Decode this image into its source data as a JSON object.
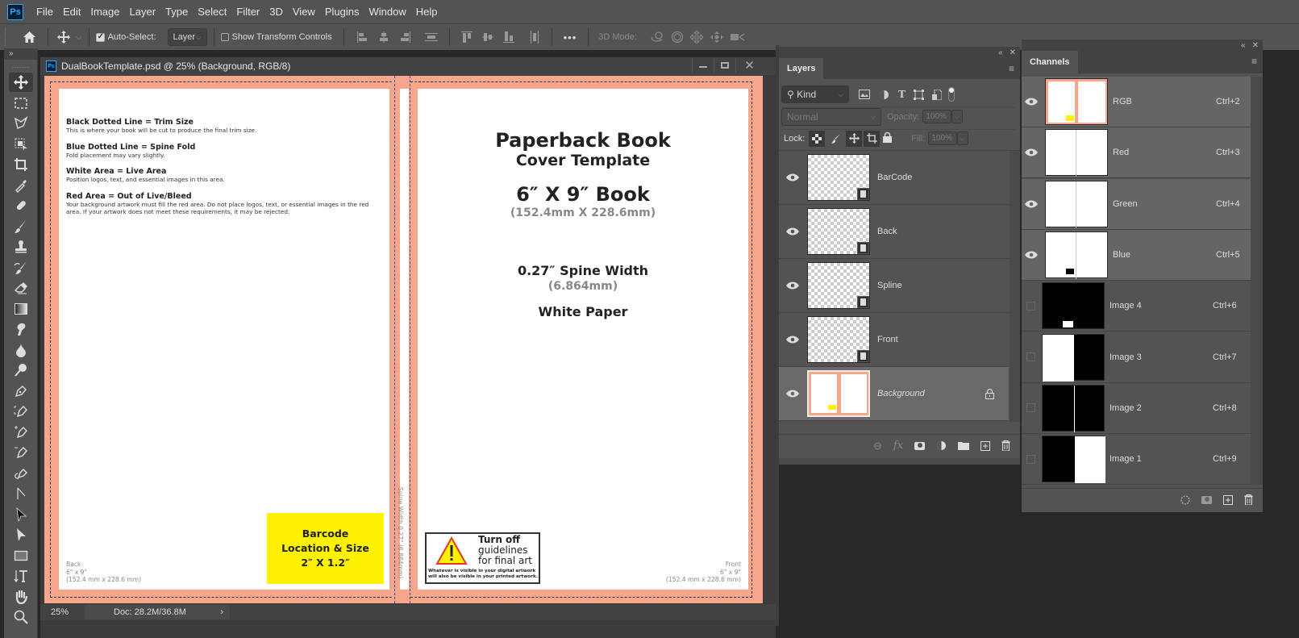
{
  "app": {
    "name": "Photoshop",
    "logo": "Ps"
  },
  "menubar": {
    "items": [
      "File",
      "Edit",
      "Image",
      "Layer",
      "Type",
      "Select",
      "Filter",
      "3D",
      "View",
      "Plugins",
      "Window",
      "Help"
    ]
  },
  "options_bar": {
    "auto_select_label": "Auto-Select:",
    "auto_select_checked": true,
    "auto_select_target": "Layer",
    "show_transform_label": "Show Transform Controls",
    "show_transform_checked": false,
    "more_label": "•••",
    "three_d_mode_label": "3D Mode:"
  },
  "toolbar": {
    "collapse_label": "»",
    "tools": [
      "move",
      "rectangular-marquee",
      "polygonal-lasso",
      "object-selection",
      "crop",
      "eyedropper",
      "spot-healing-brush",
      "brush",
      "clone-stamp",
      "history-brush",
      "eraser",
      "gradient",
      "smudge",
      "blur",
      "dodge",
      "pen",
      "curvature-pen",
      "add-anchor-point",
      "delete-anchor-point",
      "freeform-pen",
      "line-path",
      "path-selection",
      "direct-selection",
      "rectangle",
      "vertical-type",
      "hand",
      "zoom"
    ],
    "active_tool": "move"
  },
  "document": {
    "title": "DualBookTemplate.psd @ 25% (Background, RGB/8)",
    "zoom": "25%",
    "doc_size": "Doc: 28.2M/36.8M",
    "status_arrow": "›",
    "back": {
      "sections": [
        {
          "heading": "Black Dotted Line = Trim Size",
          "body": "This is where your book will be cut to produce the final trim size."
        },
        {
          "heading": "Blue Dotted Line = Spine Fold",
          "body": "Fold placement may vary slightly."
        },
        {
          "heading": "White Area = Live Area",
          "body": "Position logos, text, and essential images in this area."
        },
        {
          "heading": "Red Area = Out of Live/Bleed",
          "body": "Your background artwork must fill the red area. Do not place logos, text, or essential images in the red area. If your artwork does not meet these requirements, it may be rejected."
        }
      ],
      "corner_label": [
        "Back",
        "6\" x 9\"",
        "(152.4 mm x 228.6 mm)"
      ],
      "barcode": [
        "Barcode",
        "Location & Size",
        "2″ X 1.2″"
      ]
    },
    "spine": {
      "label": "Spine Width 0.27\" (6.864mm)"
    },
    "front": {
      "title1": "Paperback Book",
      "title2": "Cover Template",
      "size": "6″ X 9″ Book",
      "size_mm": "(152.4mm X 228.6mm)",
      "spine_width": "0.27″ Spine Width",
      "spine_mm": "(6.864mm)",
      "paper": "White Paper",
      "warning": {
        "line1": "Turn off",
        "line2": "guidelines",
        "line3": "for final art",
        "note1": "Whatever is visible in your digital artwork",
        "note2": "will also be visible in your printed artwork."
      },
      "corner_label": [
        "Front",
        "6\" x 9\"",
        "(152.4 mm x 228.6 mm)"
      ]
    },
    "colors": {
      "bleed": "#f7a58b",
      "barcode": "#fff200",
      "spine_fold": "#3a4fb0"
    }
  },
  "layers_panel": {
    "tab": "Layers",
    "filter_kind": "Kind",
    "blend_mode": "Normal",
    "opacity_label": "Opacity:",
    "opacity": "100%",
    "lock_label": "Lock:",
    "fill_label": "Fill:",
    "fill": "100%",
    "layers": [
      {
        "name": "BarCode",
        "visible": true,
        "smart_object": true
      },
      {
        "name": "Back",
        "visible": true,
        "smart_object": true
      },
      {
        "name": "Spline",
        "visible": true,
        "smart_object": true
      },
      {
        "name": "Front",
        "visible": true,
        "smart_object": true
      },
      {
        "name": "Background",
        "visible": true,
        "locked": true,
        "selected": true
      }
    ]
  },
  "channels_panel": {
    "tab": "Channels",
    "channels": [
      {
        "name": "RGB",
        "shortcut": "Ctrl+2",
        "visible": true
      },
      {
        "name": "Red",
        "shortcut": "Ctrl+3",
        "visible": true
      },
      {
        "name": "Green",
        "shortcut": "Ctrl+4",
        "visible": true
      },
      {
        "name": "Blue",
        "shortcut": "Ctrl+5",
        "visible": true
      },
      {
        "name": "Image 4",
        "shortcut": "Ctrl+6",
        "visible": false
      },
      {
        "name": "Image 3",
        "shortcut": "Ctrl+7",
        "visible": false
      },
      {
        "name": "Image 2",
        "shortcut": "Ctrl+8",
        "visible": false
      },
      {
        "name": "Image 1",
        "shortcut": "Ctrl+9",
        "visible": false
      }
    ]
  }
}
